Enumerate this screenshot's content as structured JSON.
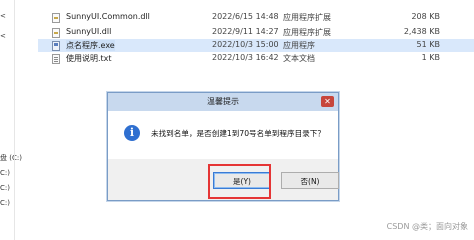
{
  "nav": {
    "items": [
      "盘 (C:)",
      "C:)",
      "C:)",
      "C:)"
    ]
  },
  "files": [
    {
      "name": "SunnyUI.Common.dll",
      "date": "2022/6/15 14:48",
      "type": "应用程序扩展",
      "size": "208 KB",
      "icon": "dll-file-icon",
      "selected": false
    },
    {
      "name": "SunnyUI.dll",
      "date": "2022/9/11 14:27",
      "type": "应用程序扩展",
      "size": "2,438 KB",
      "icon": "dll-file-icon",
      "selected": false
    },
    {
      "name": "点名程序.exe",
      "date": "2022/10/3 15:00",
      "type": "应用程序",
      "size": "51 KB",
      "icon": "exe-file-icon",
      "selected": true
    },
    {
      "name": "使用说明.txt",
      "date": "2022/10/3 16:42",
      "type": "文本文档",
      "size": "1 KB",
      "icon": "txt-file-icon",
      "selected": false
    }
  ],
  "dialog": {
    "title": "温馨提示",
    "close_symbol": "✕",
    "icon_symbol": "i",
    "message": "未找到名单，是否创建1到70号名单到程序目录下？",
    "yes_label": "是(Y)",
    "no_label": "否(N)"
  },
  "watermark": "CSDN @类；面向对象",
  "colors": {
    "highlight": "#e53535",
    "close_button": "#c7463b",
    "info_icon": "#2f6fd0"
  }
}
